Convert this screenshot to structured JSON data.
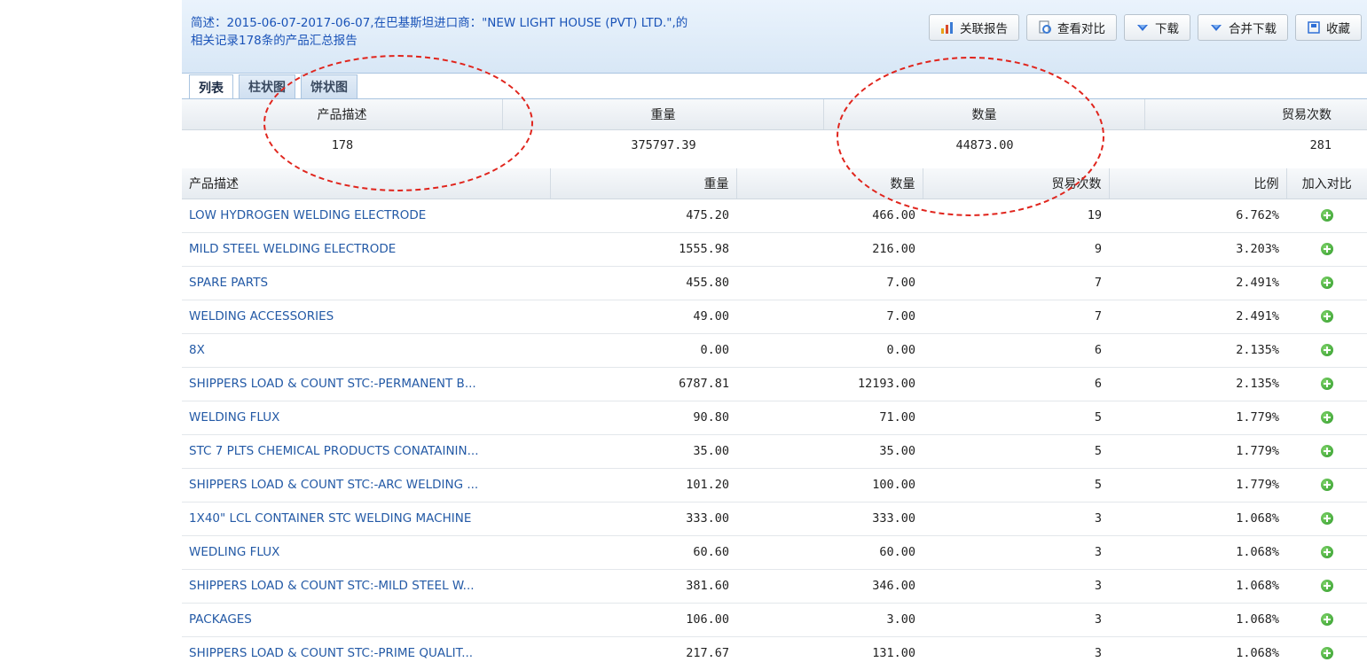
{
  "summary": {
    "line1": "简述：2015-06-07-2017-06-07,在巴基斯坦进口商：\"NEW LIGHT HOUSE (PVT) LTD.\",的",
    "line2": "相关记录178条的产品汇总报告"
  },
  "toolbar": [
    {
      "label": "关联报告",
      "icon": "chart-icon",
      "color": "#e8a317"
    },
    {
      "label": "查看对比",
      "icon": "compare-icon",
      "color": "#3a7bd5"
    },
    {
      "label": "下载",
      "icon": "download-icon",
      "color": "#2f6fd6"
    },
    {
      "label": "合并下载",
      "icon": "merge-download-icon",
      "color": "#2f6fd6"
    },
    {
      "label": "收藏",
      "icon": "bookmark-icon",
      "color": "#2f6fd6"
    }
  ],
  "tabs": [
    "列表",
    "柱状图",
    "饼状图"
  ],
  "totals": {
    "headers": [
      "产品描述",
      "重量",
      "数量",
      "贸易次数"
    ],
    "values": [
      "178",
      "375797.39",
      "44873.00",
      "281"
    ]
  },
  "detail": {
    "headers": [
      "产品描述",
      "重量",
      "数量",
      "贸易次数",
      "比例",
      "加入对比"
    ],
    "rows": [
      [
        "LOW HYDROGEN WELDING ELECTRODE",
        "475.20",
        "466.00",
        "19",
        "6.762%"
      ],
      [
        "MILD STEEL WELDING ELECTRODE",
        "1555.98",
        "216.00",
        "9",
        "3.203%"
      ],
      [
        "SPARE PARTS",
        "455.80",
        "7.00",
        "7",
        "2.491%"
      ],
      [
        "WELDING ACCESSORIES",
        "49.00",
        "7.00",
        "7",
        "2.491%"
      ],
      [
        "8X",
        "0.00",
        "0.00",
        "6",
        "2.135%"
      ],
      [
        "SHIPPERS LOAD & COUNT STC:-PERMANENT B...",
        "6787.81",
        "12193.00",
        "6",
        "2.135%"
      ],
      [
        "WELDING FLUX",
        "90.80",
        "71.00",
        "5",
        "1.779%"
      ],
      [
        "STC 7 PLTS CHEMICAL PRODUCTS CONATAININ...",
        "35.00",
        "35.00",
        "5",
        "1.779%"
      ],
      [
        "SHIPPERS LOAD & COUNT STC:-ARC WELDING ...",
        "101.20",
        "100.00",
        "5",
        "1.779%"
      ],
      [
        "1X40\" LCL CONTAINER STC WELDING MACHINE",
        "333.00",
        "333.00",
        "3",
        "1.068%"
      ],
      [
        "WEDLING FLUX",
        "60.60",
        "60.00",
        "3",
        "1.068%"
      ],
      [
        "SHIPPERS LOAD & COUNT STC:-MILD STEEL W...",
        "381.60",
        "346.00",
        "3",
        "1.068%"
      ],
      [
        "PACKAGES",
        "106.00",
        "3.00",
        "3",
        "1.068%"
      ],
      [
        "SHIPPERS LOAD & COUNT STC:-PRIME QUALIT...",
        "217.67",
        "131.00",
        "3",
        "1.068%"
      ]
    ]
  }
}
